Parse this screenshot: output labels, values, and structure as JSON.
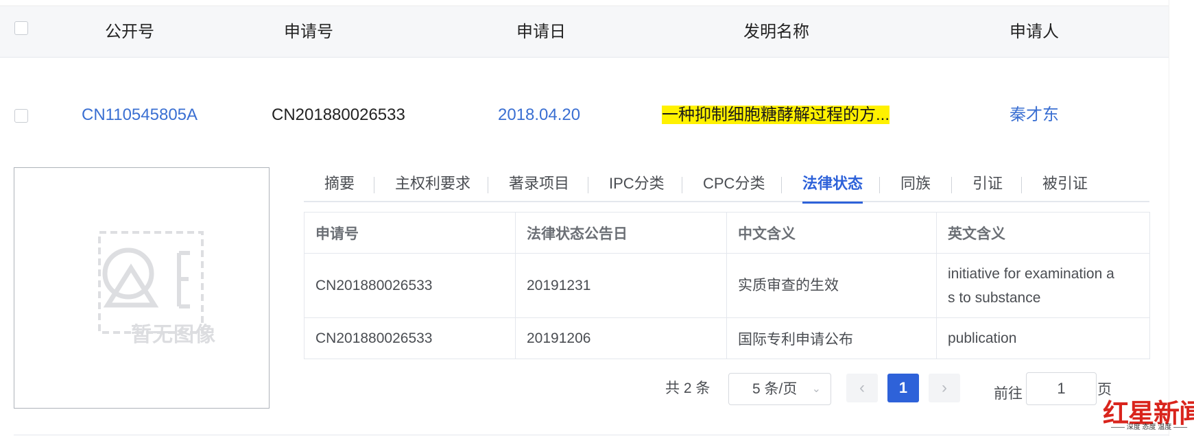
{
  "header": {
    "columns": [
      "公开号",
      "申请号",
      "申请日",
      "发明名称",
      "申请人"
    ]
  },
  "row": {
    "pub_no": "CN110545805A",
    "app_no": "CN201880026533",
    "app_date": "2018.04.20",
    "title": "一种抑制细胞糖酵解过程的方...",
    "applicant": "秦才东"
  },
  "image_placeholder": {
    "text": "暂无图像"
  },
  "tabs": [
    {
      "label": "摘要"
    },
    {
      "label": "主权利要求"
    },
    {
      "label": "著录项目"
    },
    {
      "label": "IPC分类"
    },
    {
      "label": "CPC分类"
    },
    {
      "label": "法律状态",
      "active": true
    },
    {
      "label": "同族"
    },
    {
      "label": "引证"
    },
    {
      "label": "被引证"
    }
  ],
  "legal_table": {
    "headers": [
      "申请号",
      "法律状态公告日",
      "中文含义",
      "英文含义"
    ],
    "rows": [
      [
        "CN201880026533",
        "20191231",
        "实质审查的生效",
        "initiative for examination as to substance"
      ],
      [
        "CN201880026533",
        "20191206",
        "国际专利申请公布",
        "publication"
      ]
    ],
    "row1_en_lines": [
      "initiative for examination a",
      "s to substance"
    ]
  },
  "pagination": {
    "total": "共 2 条",
    "page_size": "5 条/页",
    "prev": "‹",
    "current": "1",
    "next": "›",
    "goto_label": "前往",
    "goto_value": "1",
    "page_suffix": "页"
  },
  "watermark": {
    "main": "红星新闻",
    "sub": "—— 深度 态度 温度 ——"
  },
  "colors": {
    "link": "#3a6fd2",
    "active_tab": "#2e62d9",
    "highlight": "#fff100",
    "watermark": "#d9241c"
  }
}
